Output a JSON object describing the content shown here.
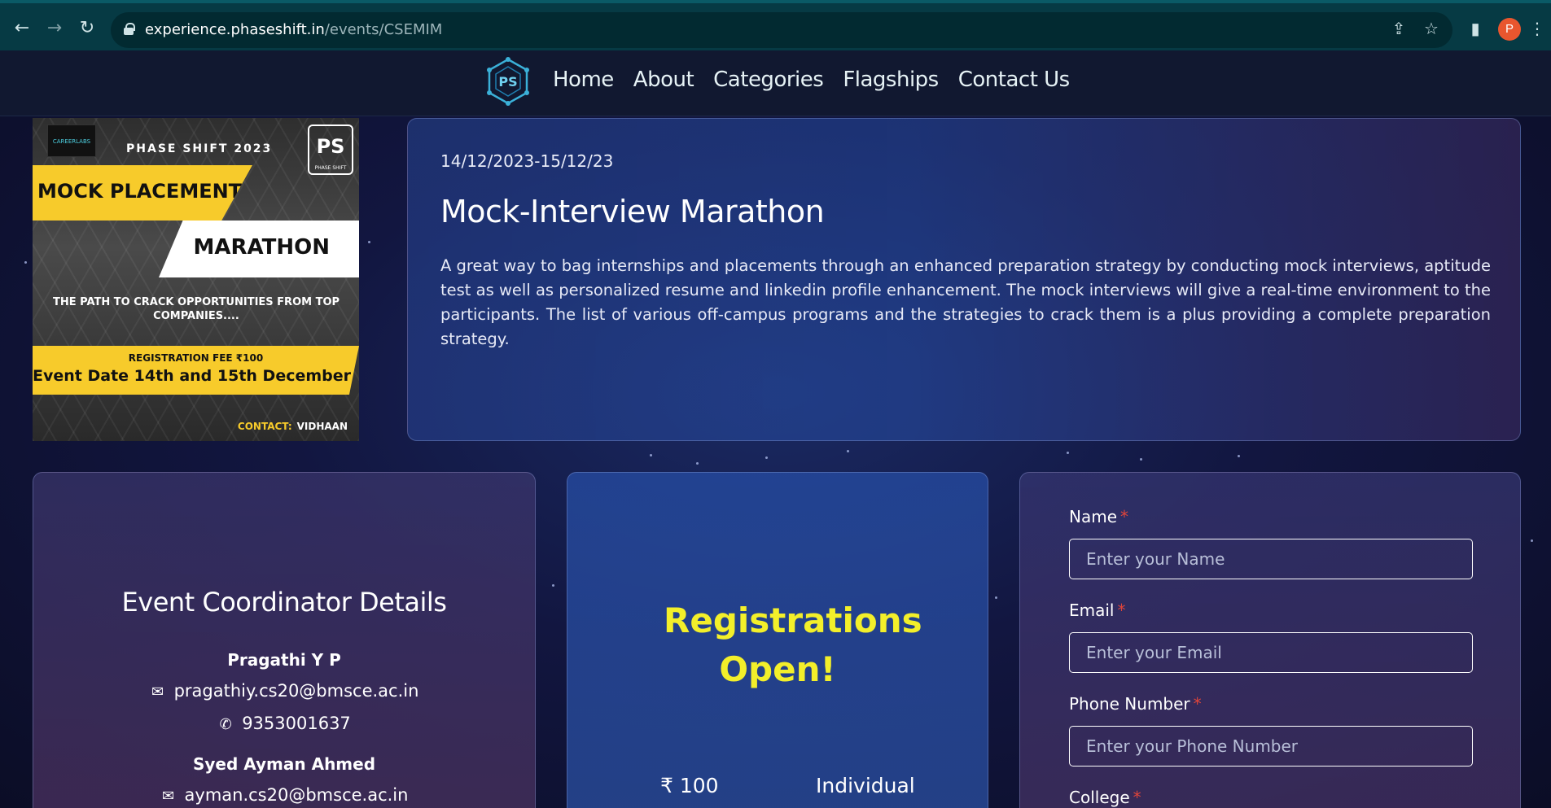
{
  "browser": {
    "url_host": "experience.phaseshift.in",
    "url_path": "/events/CSEMIM",
    "profile_initial": "P"
  },
  "nav": {
    "links": [
      "Home",
      "About",
      "Categories",
      "Flagships",
      "Contact Us"
    ]
  },
  "poster": {
    "brand": "CAREERLABS",
    "heading": "PHASE SHIFT 2023",
    "ps_logo": "PS",
    "ps_logo_caption": "PHASE SHIFT",
    "line1": "MOCK PLACEMENT",
    "line2": "MARATHON",
    "tagline": "THE PATH TO CRACK OPPORTUNITIES FROM TOP COMPANIES....",
    "fee": "REGISTRATION FEE ₹100",
    "event_date": "Event Date 14th and 15th December",
    "contact_label": "CONTACT:",
    "contact_name": "VIDHAAN"
  },
  "event": {
    "date": "14/12/2023-15/12/23",
    "title": "Mock-Interview Marathon",
    "description": "A great way to bag internships and placements through an enhanced preparation strategy by conducting mock interviews, aptitude test as well as personalized resume and linkedin profile enhancement. The mock interviews will give a real-time environment to the participants. The list of various off-campus programs and the strategies to crack them is a plus providing a complete preparation strategy."
  },
  "coordinators": {
    "heading": "Event Coordinator Details",
    "people": [
      {
        "name": "Pragathi Y P",
        "email": "pragathiy.cs20@bmsce.ac.in",
        "phone": "9353001637"
      },
      {
        "name": "Syed Ayman Ahmed",
        "email": "ayman.cs20@bmsce.ac.in"
      }
    ]
  },
  "registration": {
    "status": "Registrations Open!",
    "fee": "₹ 100",
    "type": "Individual"
  },
  "form": {
    "name_label": "Name",
    "name_placeholder": "Enter your Name",
    "email_label": "Email",
    "email_placeholder": "Enter your Email",
    "phone_label": "Phone Number",
    "phone_placeholder": "Enter your Phone Number",
    "college_label": "College",
    "required_mark": "*"
  },
  "colors": {
    "accent_yellow": "#f3ef2a",
    "required_red": "#e0453a",
    "poster_yellow": "#f7cb2b",
    "avatar": "#e8562e"
  }
}
